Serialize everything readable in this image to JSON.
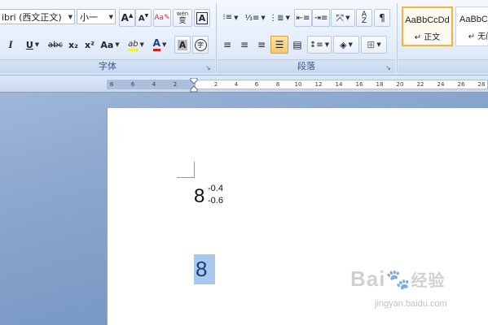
{
  "ribbon": {
    "font_group": {
      "label": "字体",
      "font_name": "ibri (西文正文)",
      "font_size": "小一",
      "grow_font_icon": "grow-font-icon",
      "shrink_font_icon": "shrink-font-icon",
      "clear_format_icon": "clear-format-icon",
      "phonetic_label": "wén",
      "phonetic_char": "变",
      "char_border_label": "A",
      "italic_label": "I",
      "underline_label": "U",
      "strike_label": "abc",
      "subscript_label": "x₂",
      "superscript_label": "x²",
      "change_case_label": "Aa",
      "highlight_label": "ab",
      "font_color_label": "A",
      "char_shading_label": "A",
      "enclose_label": "字",
      "highlight_color": "#f6ef3a",
      "font_color": "#d22020"
    },
    "paragraph_group": {
      "label": "段落",
      "bullets_icon": "bullets-icon",
      "numbering_icon": "numbering-icon",
      "multilevel_icon": "multilevel-list-icon",
      "decrease_indent_icon": "decrease-indent-icon",
      "increase_indent_icon": "increase-indent-icon",
      "chinese_layout_icon": "chinese-layout-icon",
      "sort_icon": "sort-icon",
      "show_marks_icon": "paragraph-marks-icon",
      "align_left_icon": "align-left-icon",
      "align_center_icon": "align-center-icon",
      "align_right_icon": "align-right-icon",
      "justify_icon": "justify-icon",
      "distributed_icon": "distributed-icon",
      "line_spacing_icon": "line-spacing-icon",
      "shading_icon": "shading-icon",
      "borders_icon": "borders-icon"
    },
    "styles": [
      {
        "preview": "AaBbCcDd",
        "name": "↵ 正文",
        "selected": true
      },
      {
        "preview": "AaBbC",
        "name": "↵ 无间",
        "selected": false
      }
    ]
  },
  "ruler": {
    "ticks": [
      "8",
      "6",
      "4",
      "2",
      "2",
      "4",
      "6",
      "8",
      "10",
      "12",
      "14",
      "16",
      "18",
      "20",
      "22",
      "24",
      "26",
      "28"
    ]
  },
  "document": {
    "math_base": "8",
    "math_superscript": "-0.4",
    "math_subscript": "-0.6",
    "selected_text": "8"
  },
  "watermark": {
    "brand": "Bai",
    "brand_suffix": "经验",
    "url": "jingyan.baidu.com"
  }
}
